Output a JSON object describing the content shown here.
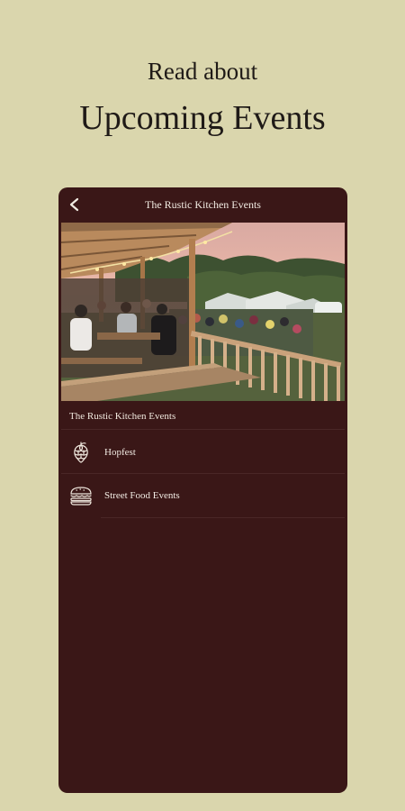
{
  "promo": {
    "subtitle": "Read about",
    "title": "Upcoming Events"
  },
  "app": {
    "header_title": "The Rustic Kitchen Events",
    "section_title": "The Rustic Kitchen Events",
    "items": [
      {
        "label": "Hopfest",
        "icon": "hop-icon"
      },
      {
        "label": "Street Food Events",
        "icon": "burger-icon"
      }
    ]
  },
  "colors": {
    "page_background": "#dad6ad",
    "app_background": "#3a1717",
    "text_light": "#f2ece4"
  }
}
